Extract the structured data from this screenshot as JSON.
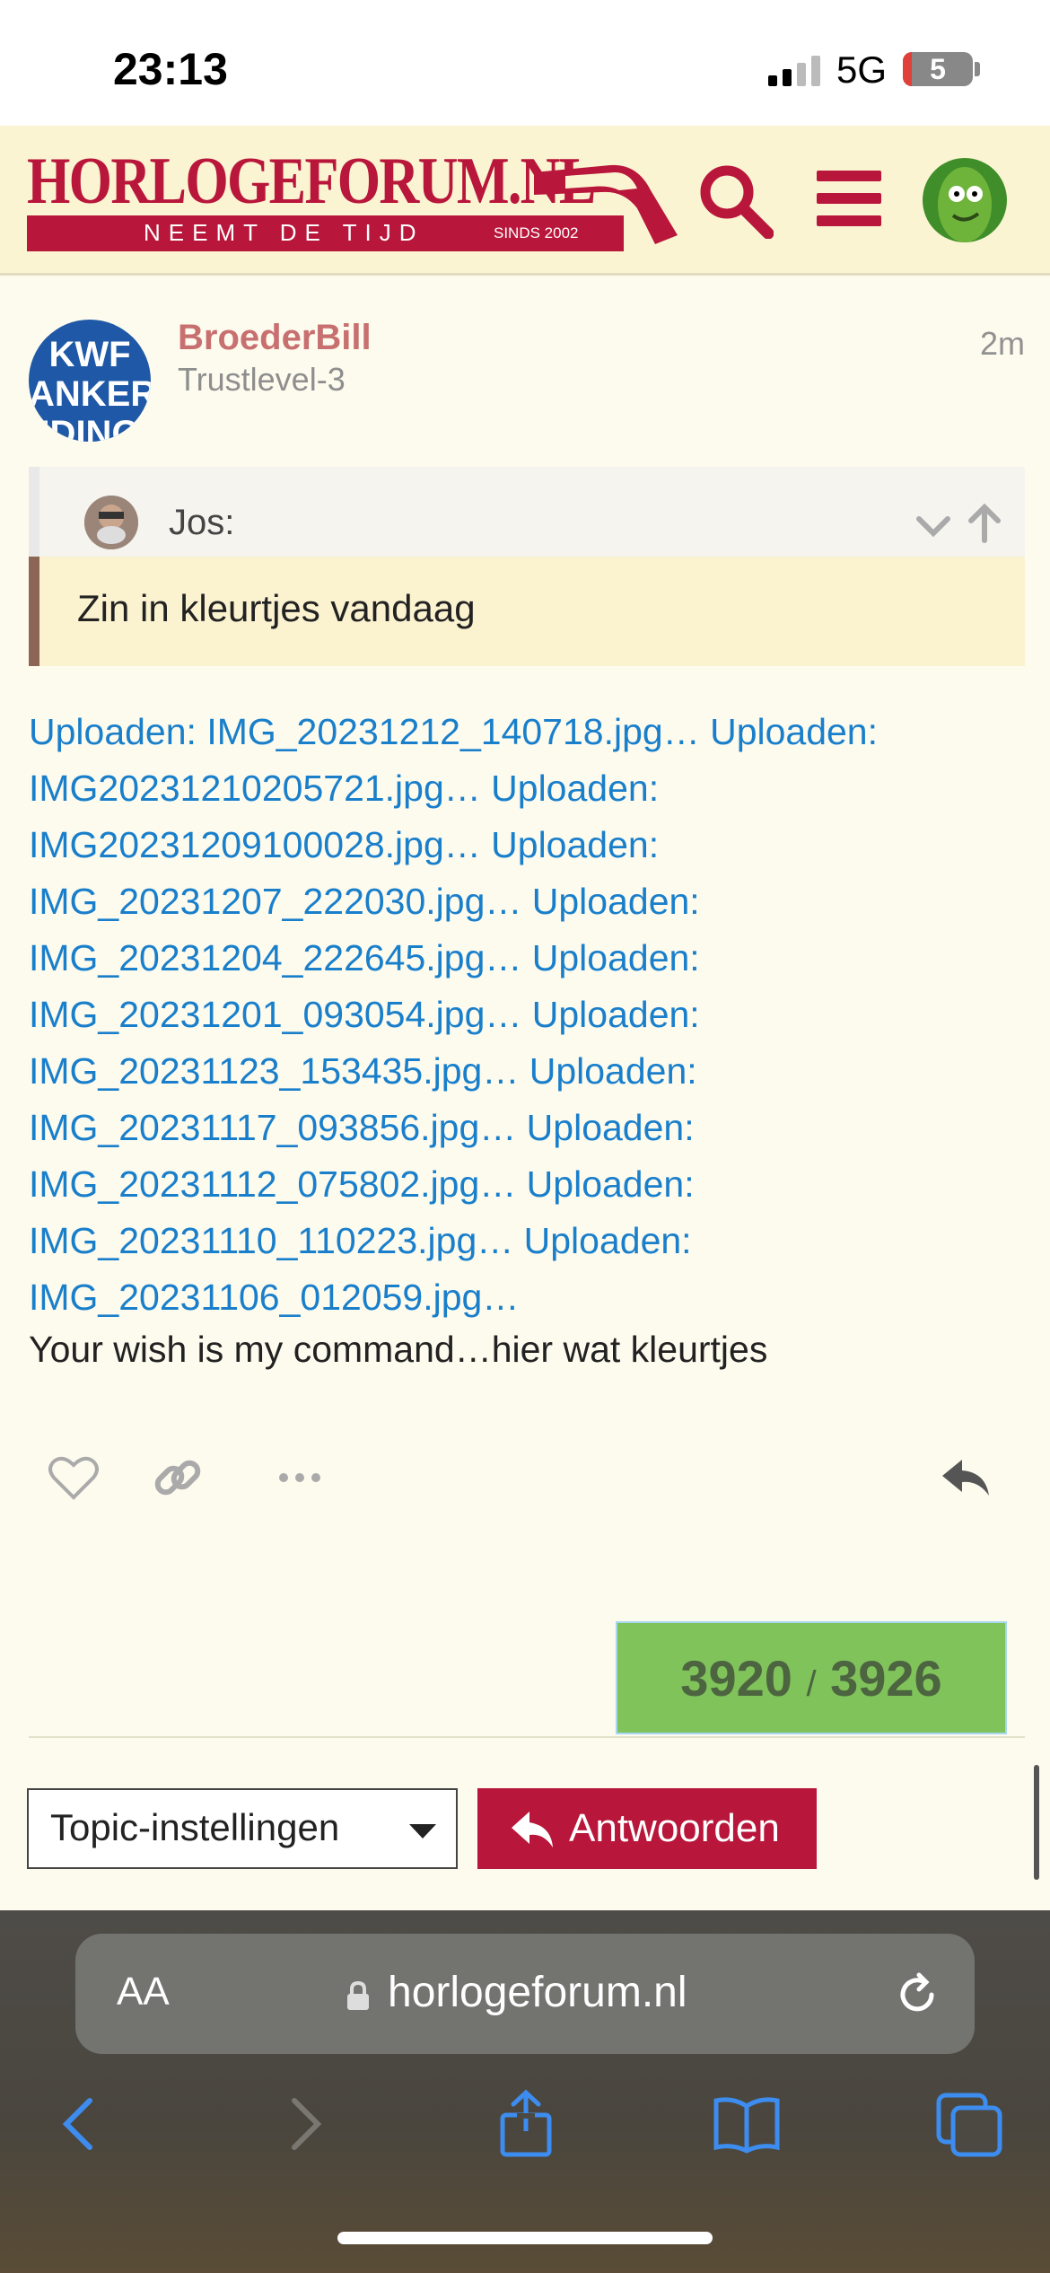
{
  "status_bar": {
    "time": "23:13",
    "network": "5G",
    "battery": "5"
  },
  "header": {
    "logo_text": "HORLOGEFORUM.NL",
    "logo_tagline": "NEEMT DE TIJD",
    "logo_since": "SINDS 2002",
    "icons": [
      "search-icon",
      "hamburger-menu-icon",
      "user-avatar"
    ]
  },
  "post": {
    "avatar_lines": [
      "KWF",
      "ANKER",
      "IDING"
    ],
    "username": "BroederBill",
    "user_title": "Trustlevel-3",
    "time": "2m",
    "quote": {
      "author": "Jos:",
      "text": "Zin in kleurtjes vandaag"
    },
    "upload_lines": [
      "Uploaden: IMG_20231212_140718.jpg… Uploaden:",
      "IMG20231210205721.jpg… Uploaden:",
      "IMG20231209100028.jpg… Uploaden:",
      "IMG_20231207_222030.jpg… Uploaden:",
      "IMG_20231204_222645.jpg… Uploaden:",
      "IMG_20231201_093054.jpg… Uploaden:",
      "IMG_20231123_153435.jpg… Uploaden:",
      "IMG_20231117_093856.jpg… Uploaden:",
      "IMG_20231112_075802.jpg… Uploaden:",
      "IMG_20231110_110223.jpg… Uploaden:",
      "IMG_20231106_012059.jpg…"
    ],
    "body_text": "Your wish is my command…hier wat kleurtjes",
    "actions": [
      "heart-icon",
      "link-icon",
      "more-icon",
      "reply-icon"
    ]
  },
  "progress": {
    "current": "3920",
    "separator": "/",
    "total": "3926"
  },
  "footer": {
    "topic_settings": "Topic-instellingen",
    "reply_label": "Antwoorden"
  },
  "safari": {
    "aa_label": "AA",
    "url": "horlogeforum.nl"
  },
  "colors": {
    "brand": "#b8163a",
    "link": "#1a7fcb",
    "progress": "#7fc35a",
    "background": "#fdfbee"
  }
}
